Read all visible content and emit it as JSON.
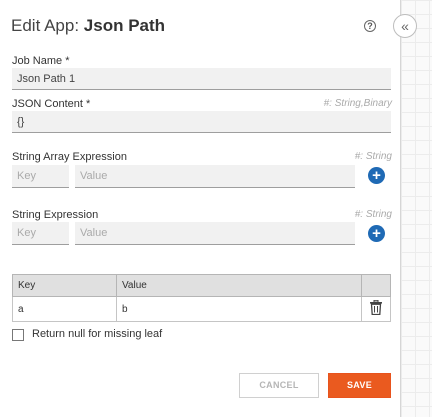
{
  "header": {
    "title_prefix": "Edit App:",
    "app_name": "Json Path",
    "help_icon": "help-circle-icon",
    "collapse_icon": "double-chevron-left-icon"
  },
  "form": {
    "job_name": {
      "label": "Job Name *",
      "value": "Json Path 1"
    },
    "json_content": {
      "label": "JSON Content *",
      "type_hint": "#: String,Binary",
      "value": "{}"
    },
    "string_array_expression": {
      "label": "String Array Expression",
      "type_hint": "#: String",
      "key_placeholder": "Key",
      "value_placeholder": "Value",
      "add_icon": "plus-icon"
    },
    "string_expression": {
      "label": "String Expression",
      "type_hint": "#: String",
      "key_placeholder": "Key",
      "value_placeholder": "Value",
      "add_icon": "plus-icon"
    },
    "table": {
      "columns": [
        "Key",
        "Value"
      ],
      "rows": [
        {
          "key": "a",
          "value": "b",
          "action_icon": "trash-icon"
        }
      ]
    },
    "return_null": {
      "label": "Return null for missing leaf",
      "checked": false
    }
  },
  "actions": {
    "cancel_label": "CANCEL",
    "save_label": "SAVE"
  },
  "colors": {
    "accent": "#1f6ab5",
    "save": "#ea5a1f"
  }
}
